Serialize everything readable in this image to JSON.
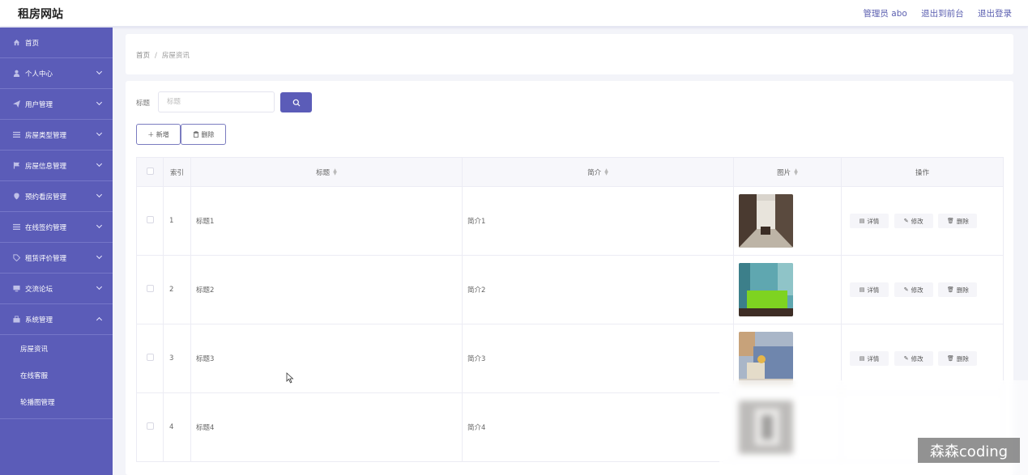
{
  "header": {
    "brand": "租房网站",
    "admin_label": "管理员 abo",
    "front_link": "退出到前台",
    "logout_link": "退出登录"
  },
  "sidebar": {
    "items": [
      {
        "label": "首页",
        "icon": "home-icon",
        "arrow": "none"
      },
      {
        "label": "个人中心",
        "icon": "user-icon",
        "arrow": "down"
      },
      {
        "label": "用户管理",
        "icon": "send-icon",
        "arrow": "down"
      },
      {
        "label": "房屋类型管理",
        "icon": "list-icon",
        "arrow": "down"
      },
      {
        "label": "房屋信息管理",
        "icon": "flag-icon",
        "arrow": "down"
      },
      {
        "label": "预约看房管理",
        "icon": "location-icon",
        "arrow": "down"
      },
      {
        "label": "在线签约管理",
        "icon": "list-icon",
        "arrow": "down"
      },
      {
        "label": "租赁评价管理",
        "icon": "tag-icon",
        "arrow": "down"
      },
      {
        "label": "交流论坛",
        "icon": "monitor-icon",
        "arrow": "down"
      },
      {
        "label": "系统管理",
        "icon": "bag-icon",
        "arrow": "up"
      }
    ],
    "submenu": [
      "房屋资讯",
      "在线客服",
      "轮播图管理"
    ]
  },
  "breadcrumb": {
    "home": "首页",
    "separator": "/",
    "current": "房屋资讯"
  },
  "search": {
    "label": "标题",
    "placeholder": "标题",
    "value": ""
  },
  "toolbar": {
    "add_label": "＋ 新增",
    "delete_label": "删除"
  },
  "table": {
    "headers": {
      "index": "索引",
      "title": "标题",
      "intro": "简介",
      "image": "图片",
      "actions": "操作"
    },
    "rows": [
      {
        "index": "1",
        "title": "标题1",
        "intro": "简介1",
        "image": "room-photo-dining"
      },
      {
        "index": "2",
        "title": "标题2",
        "intro": "简介2",
        "image": "room-photo-bedroom"
      },
      {
        "index": "3",
        "title": "标题3",
        "intro": "简介3",
        "image": "room-photo-living"
      },
      {
        "index": "4",
        "title": "标题4",
        "intro": "简介4",
        "image": "room-photo-blurred"
      }
    ],
    "actions": {
      "detail": "详情",
      "edit": "修改",
      "delete": "删除"
    }
  },
  "watermark": "森森coding",
  "colors": {
    "primary": "#5b5cb8",
    "sidebar_bg": "#5b5cb8",
    "page_bg": "#f3f4f9"
  }
}
